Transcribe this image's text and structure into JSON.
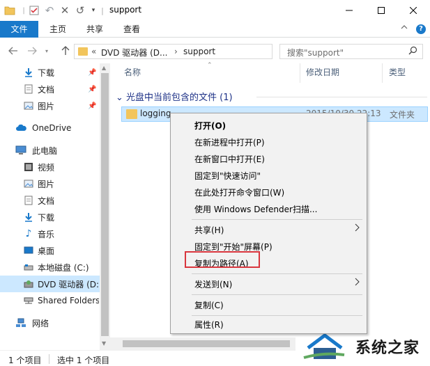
{
  "window": {
    "title": "support"
  },
  "ribbon": {
    "tabs": [
      "文件",
      "主页",
      "共享",
      "查看"
    ]
  },
  "address": {
    "overflow": "«",
    "crumb_1": "DVD 驱动器 (D...",
    "separator": "›",
    "crumb_2": "support",
    "search_placeholder": "搜索\"support\""
  },
  "nav": {
    "items": [
      {
        "label": "下载",
        "icon": "download-icon",
        "pinned": true
      },
      {
        "label": "文档",
        "icon": "document-icon",
        "pinned": true
      },
      {
        "label": "图片",
        "icon": "pictures-icon",
        "pinned": true
      },
      {
        "label": "OneDrive",
        "icon": "cloud-icon"
      },
      {
        "label": "此电脑",
        "icon": "computer-icon"
      },
      {
        "label": "视频",
        "icon": "video-icon"
      },
      {
        "label": "图片",
        "icon": "pictures-icon"
      },
      {
        "label": "文档",
        "icon": "document-icon"
      },
      {
        "label": "下载",
        "icon": "download-icon"
      },
      {
        "label": "音乐",
        "icon": "music-icon"
      },
      {
        "label": "桌面",
        "icon": "desktop-icon"
      },
      {
        "label": "本地磁盘 (C:)",
        "icon": "drive-icon"
      },
      {
        "label": "DVD 驱动器 (D:",
        "icon": "dvd-icon",
        "selected": true
      },
      {
        "label": "Shared Folders",
        "icon": "network-drive-icon"
      },
      {
        "label": "网络",
        "icon": "network-icon"
      }
    ]
  },
  "content": {
    "columns": {
      "name": "名称",
      "date": "修改日期",
      "type": "类型"
    },
    "group_header": "光盘中当前包含的文件 (1)",
    "rows": [
      {
        "name": "logging",
        "date": "2015/10/30 22:13",
        "type": "文件夹"
      }
    ]
  },
  "context_menu": {
    "items": [
      {
        "label": "打开(O)",
        "bold": true
      },
      {
        "label": "在新进程中打开(P)"
      },
      {
        "label": "在新窗口中打开(E)"
      },
      {
        "label": "固定到\"快速访问\""
      },
      {
        "label": "在此处打开命令窗口(W)"
      },
      {
        "label": "使用 Windows Defender扫描..."
      },
      {
        "label": "共享(H)",
        "submenu": true
      },
      {
        "label": "固定到\"开始\"屏幕(P)"
      },
      {
        "label": "复制为路径(A)",
        "highlighted": true
      },
      {
        "label": "发送到(N)",
        "submenu": true
      },
      {
        "label": "复制(C)"
      },
      {
        "label": "属性(R)"
      }
    ]
  },
  "status": {
    "item_count": "1 个项目",
    "selected": "选中 1 个项目"
  },
  "watermark": {
    "text": "系统之家"
  },
  "colors": {
    "accent": "#1979ca",
    "selection": "#cce8ff",
    "highlight_box": "#d9363e",
    "folder": "#f2c55c"
  }
}
